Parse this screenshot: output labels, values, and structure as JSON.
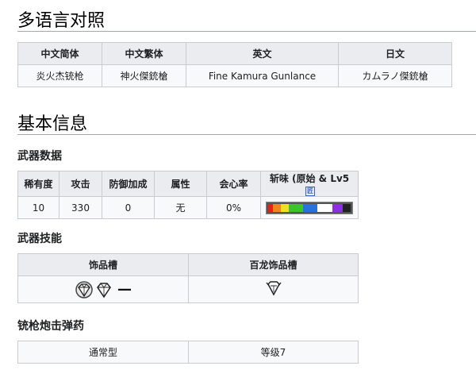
{
  "sections": {
    "multilang_title": "多语言对照",
    "basic_title": "基本信息"
  },
  "lang_table": {
    "headers": [
      "中文简体",
      "中文繁体",
      "英文",
      "日文"
    ],
    "values": [
      "炎火杰铳枪",
      "神火傑銃槍",
      "Fine Kamura Gunlance",
      "カムラノ傑銃槍"
    ]
  },
  "weapon_data": {
    "title": "武器数据",
    "headers": [
      "稀有度",
      "攻击",
      "防御加成",
      "属性",
      "会心率",
      "斩味 (原始 & Lv5"
    ],
    "values": [
      "10",
      "330",
      "0",
      "无",
      "0%"
    ],
    "help_icon_text": "匠",
    "sharpness": [
      {
        "color": "#e8201d",
        "pct": 6
      },
      {
        "color": "#f4831f",
        "pct": 9
      },
      {
        "color": "#f1e01f",
        "pct": 10
      },
      {
        "color": "#3ec32b",
        "pct": 17
      },
      {
        "color": "#2a6fe0",
        "pct": 18
      },
      {
        "color": "#ffffff",
        "pct": 18
      },
      {
        "color": "#8f2fe3",
        "pct": 12
      },
      {
        "color": "#222222",
        "pct": 10
      }
    ]
  },
  "skills": {
    "title": "武器技能",
    "headers": [
      "饰品槽",
      "百龙饰品槽"
    ],
    "deco_dash": "—"
  },
  "shell": {
    "title": "铳枪炮击弹药",
    "type": "通常型",
    "level": "等级7"
  }
}
